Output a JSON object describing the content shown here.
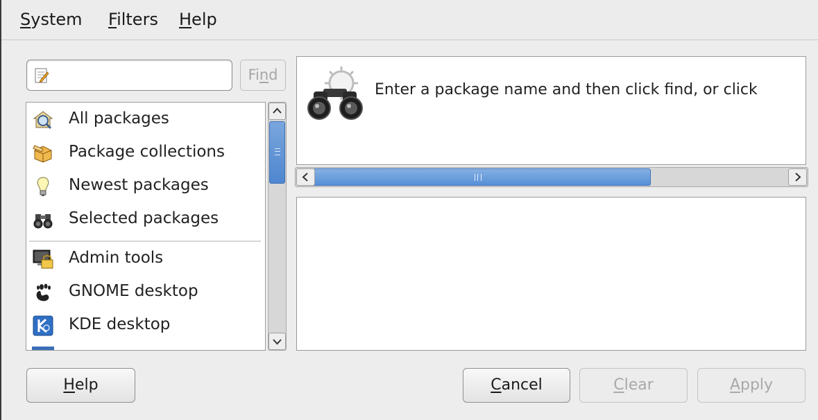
{
  "menubar": {
    "items": [
      {
        "mnemonic": "S",
        "rest": "ystem"
      },
      {
        "mnemonic": "F",
        "rest": "ilters"
      },
      {
        "mnemonic": "H",
        "rest": "elp"
      }
    ]
  },
  "search": {
    "value": "",
    "placeholder": "",
    "find_label_pre": "Fi",
    "find_mnemonic": "n",
    "find_label_post": "d"
  },
  "categories": [
    {
      "label": "All packages",
      "icon": "magnifier-icon"
    },
    {
      "label": "Package collections",
      "icon": "box-icon"
    },
    {
      "label": "Newest packages",
      "icon": "lightbulb-icon"
    },
    {
      "label": "Selected packages",
      "icon": "binoculars-icon"
    },
    {
      "label": "Admin tools",
      "icon": "admin-lock-icon"
    },
    {
      "label": "GNOME desktop",
      "icon": "gnome-foot-icon"
    },
    {
      "label": "KDE desktop",
      "icon": "kde-icon"
    }
  ],
  "description": {
    "text": "Enter a package name and then click find, or click",
    "icon": "binoculars-gear-icon"
  },
  "buttons": {
    "help": {
      "mnemonic": "H",
      "rest": "elp"
    },
    "cancel": {
      "mnemonic": "C",
      "rest": "ancel"
    },
    "clear": {
      "mnemonic": "C",
      "rest": "lear"
    },
    "apply": {
      "mnemonic": "A",
      "rest": "pply"
    }
  },
  "colors": {
    "scrollbar_thumb": "#5690d6",
    "window_bg": "#ededed",
    "disabled_text": "#a9a9a9"
  }
}
